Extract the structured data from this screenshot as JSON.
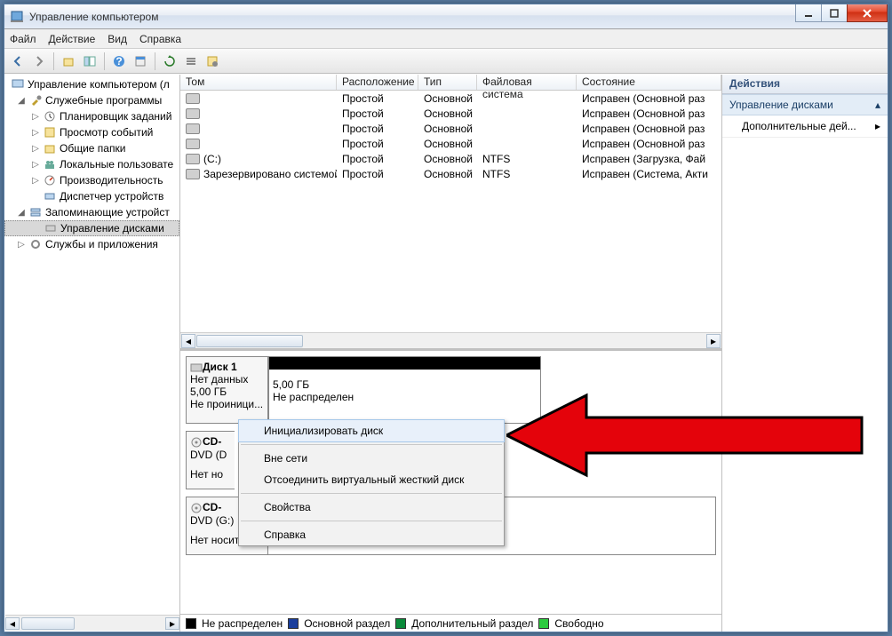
{
  "window": {
    "title": "Управление компьютером"
  },
  "menu": {
    "file": "Файл",
    "action": "Действие",
    "view": "Вид",
    "help": "Справка"
  },
  "tree": {
    "root": "Управление компьютером (л",
    "tools": "Служебные программы",
    "scheduler": "Планировщик заданий",
    "events": "Просмотр событий",
    "shared": "Общие папки",
    "users": "Локальные пользовате",
    "perf": "Производительность",
    "devmgr": "Диспетчер устройств",
    "storage": "Запоминающие устройст",
    "diskmgmt": "Управление дисками",
    "services": "Службы и приложения"
  },
  "columns": {
    "volume": "Том",
    "layout": "Расположение",
    "type": "Тип",
    "fs": "Файловая система",
    "status": "Состояние"
  },
  "volumes": [
    {
      "name": "",
      "layout": "Простой",
      "type": "Основной",
      "fs": "",
      "status": "Исправен (Основной раз"
    },
    {
      "name": "",
      "layout": "Простой",
      "type": "Основной",
      "fs": "",
      "status": "Исправен (Основной раз"
    },
    {
      "name": "",
      "layout": "Простой",
      "type": "Основной",
      "fs": "",
      "status": "Исправен (Основной раз"
    },
    {
      "name": "",
      "layout": "Простой",
      "type": "Основной",
      "fs": "",
      "status": "Исправен (Основной раз"
    },
    {
      "name": "(C:)",
      "layout": "Простой",
      "type": "Основной",
      "fs": "NTFS",
      "status": "Исправен (Загрузка, Фай"
    },
    {
      "name": "Зарезервировано системой",
      "layout": "Простой",
      "type": "Основной",
      "fs": "NTFS",
      "status": "Исправен (Система, Акти"
    }
  ],
  "disk1": {
    "title": "Диск 1",
    "line1": "Нет данных",
    "line2": "5,00 ГБ",
    "line3": "Не проиници...",
    "part_size": "5,00 ГБ",
    "part_status": "Не распределен"
  },
  "cd0": {
    "title": "CD-",
    "line1": "DVD (D",
    "line2": "Нет но"
  },
  "cd1": {
    "title": "CD-",
    "line1": "DVD (G:)",
    "line2": "Нет носителя"
  },
  "context": {
    "init": "Инициализировать диск",
    "offline": "Вне сети",
    "detach": "Отсоединить виртуальный жесткий диск",
    "props": "Свойства",
    "help": "Справка"
  },
  "legend": {
    "unalloc": "Не распределен",
    "primary": "Основной раздел",
    "extended": "Дополнительный раздел",
    "free": "Свободно"
  },
  "actions": {
    "header": "Действия",
    "diskmgmt": "Управление дисками",
    "more": "Дополнительные дей..."
  }
}
